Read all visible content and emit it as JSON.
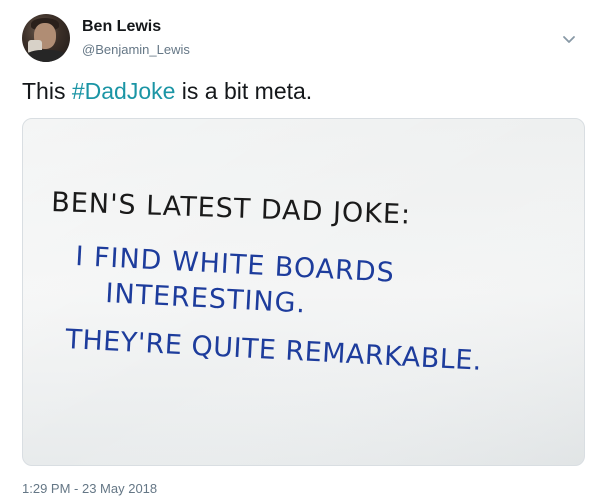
{
  "author": {
    "name": "Ben Lewis",
    "handle": "@Benjamin_Lewis"
  },
  "tweet": {
    "text_before": "This ",
    "hashtag": "#DadJoke",
    "text_after": " is a bit meta."
  },
  "photo": {
    "lines": [
      "BEN'S LATEST DAD JOKE:",
      "I FIND WHITE BOARDS",
      "INTERESTING.",
      "THEY'RE QUITE REMARKABLE."
    ],
    "ink_black": "#1a1a1a",
    "ink_blue": "#1d3c9c"
  },
  "timestamp": "1:29 PM - 23 May 2018",
  "icons": {
    "menu": "chevron-down-icon"
  },
  "colors": {
    "hashtag": "#1b95a5",
    "secondary_text": "#657786"
  }
}
